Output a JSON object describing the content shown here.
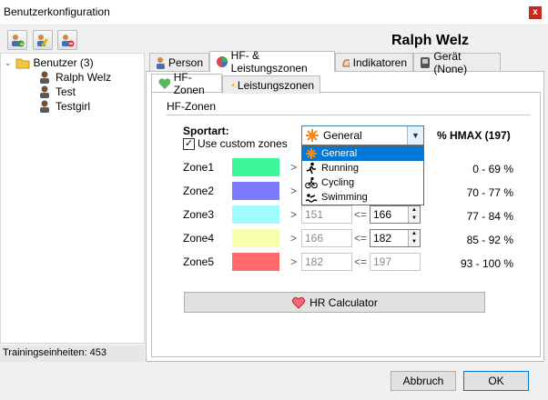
{
  "window": {
    "title": "Benutzerkonfiguration",
    "close_glyph": "x"
  },
  "header": {
    "user_name": "Ralph Welz"
  },
  "toolbar": {
    "icons": [
      "add-user-icon",
      "edit-user-icon",
      "delete-user-icon"
    ]
  },
  "tree": {
    "root": "Benutzer (3)",
    "users": [
      "Ralph Welz",
      "Test",
      "Testgirl"
    ],
    "status": "Trainingseinheiten: 453"
  },
  "outer_tabs": [
    "Person",
    "HF- & Leistungszonen",
    "Indikatoren",
    "Gerät (None)"
  ],
  "inner_tabs": [
    "HF-Zonen",
    "Leistungszonen"
  ],
  "hf": {
    "group_title": "HF-Zonen",
    "sport_label": "Sportart:",
    "custom_label": "Use custom zones",
    "custom_checked": "✓",
    "selected_sport": "General",
    "sport_options": [
      "General",
      "Running",
      "Cycling",
      "Swimming"
    ],
    "hmax_header": "% HMAX (197)",
    "gt": ">",
    "le": "<=",
    "zones": [
      {
        "label": "Zone1",
        "color": "#3df59a",
        "low": "",
        "high": "",
        "pct": "0 - 69 %"
      },
      {
        "label": "Zone2",
        "color": "#7a7aff",
        "low": "",
        "high": "",
        "pct": "70 - 77 %"
      },
      {
        "label": "Zone3",
        "color": "#9efcff",
        "low": "151",
        "high": "166",
        "pct": "77 - 84 %"
      },
      {
        "label": "Zone4",
        "color": "#f7ffae",
        "low": "166",
        "high": "182",
        "pct": "85 - 92 %"
      },
      {
        "label": "Zone5",
        "color": "#ff6a6a",
        "low": "182",
        "high": "197",
        "pct": "93 - 100 %"
      }
    ],
    "calc_button": "HR Calculator"
  },
  "footer": {
    "cancel": "Abbruch",
    "ok": "OK"
  }
}
